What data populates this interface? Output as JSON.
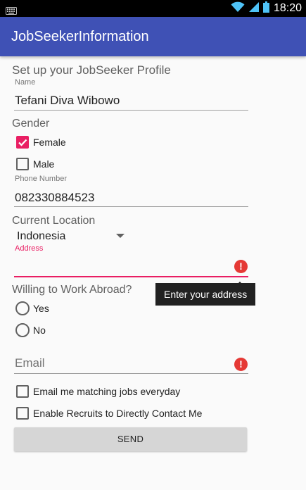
{
  "status_bar": {
    "time": "18:20",
    "icons": [
      "keyboard-icon",
      "wifi-icon",
      "signal-icon",
      "battery-icon"
    ]
  },
  "app_bar": {
    "title": "JobSeekerInformation"
  },
  "form": {
    "heading": "Set up your JobSeeker Profile",
    "name": {
      "label": "Name",
      "value": "Tefani Diva Wibowo"
    },
    "gender": {
      "label": "Gender",
      "options": [
        {
          "label": "Female",
          "checked": true
        },
        {
          "label": "Male",
          "checked": false
        }
      ]
    },
    "phone": {
      "label": "Phone Number",
      "value": "082330884523"
    },
    "location": {
      "label": "Current Location",
      "selected": "Indonesia"
    },
    "address": {
      "label": "Address",
      "value": "",
      "error": "Enter your address"
    },
    "abroad": {
      "label": "Willing to Work Abroad?",
      "options": [
        {
          "label": "Yes",
          "selected": false
        },
        {
          "label": "No",
          "selected": false
        }
      ]
    },
    "email": {
      "placeholder": "Email",
      "value": ""
    },
    "checkboxes": [
      {
        "label": "Email me matching jobs everyday",
        "checked": false
      },
      {
        "label": "Enable Recruits to Directly Contact Me",
        "checked": false
      }
    ],
    "send_label": "SEND"
  },
  "colors": {
    "primary": "#3f51b5",
    "accent": "#e91e63",
    "error": "#e53935",
    "background": "#fafafa"
  }
}
